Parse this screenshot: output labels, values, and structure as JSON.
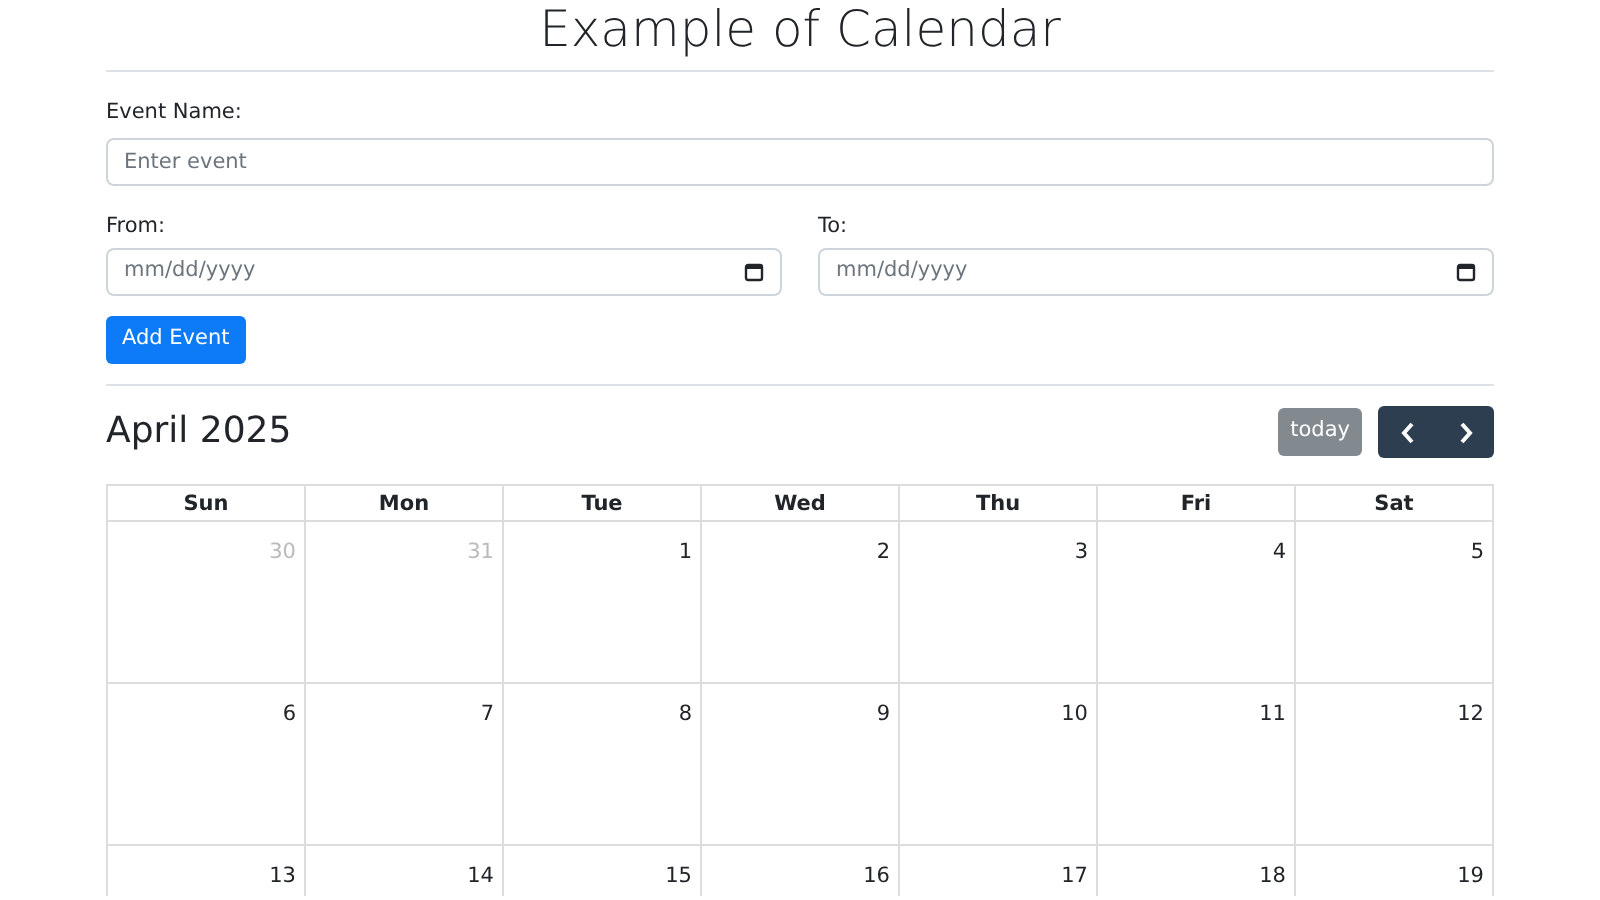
{
  "title": "Example of Calendar",
  "form": {
    "event_name": {
      "label": "Event Name:",
      "placeholder": "Enter event"
    },
    "from": {
      "label": "From:",
      "placeholder": "mm/dd/yyyy"
    },
    "to": {
      "label": "To:",
      "placeholder": "mm/dd/yyyy"
    },
    "submit": "Add Event"
  },
  "calendar": {
    "month": "April 2025",
    "today_button": {
      "label": "today",
      "disabled": true
    },
    "weekdays": [
      "Sun",
      "Mon",
      "Tue",
      "Wed",
      "Thu",
      "Fri",
      "Sat"
    ],
    "weeks": [
      [
        {
          "day": "30",
          "other_month": true
        },
        {
          "day": "31",
          "other_month": true
        },
        {
          "day": "1",
          "other_month": false
        },
        {
          "day": "2",
          "other_month": false
        },
        {
          "day": "3",
          "other_month": false
        },
        {
          "day": "4",
          "other_month": false
        },
        {
          "day": "5",
          "other_month": false
        }
      ],
      [
        {
          "day": "6",
          "other_month": false
        },
        {
          "day": "7",
          "other_month": false
        },
        {
          "day": "8",
          "other_month": false
        },
        {
          "day": "9",
          "other_month": false
        },
        {
          "day": "10",
          "other_month": false
        },
        {
          "day": "11",
          "other_month": false
        },
        {
          "day": "12",
          "other_month": false
        }
      ],
      [
        {
          "day": "13",
          "other_month": false
        },
        {
          "day": "14",
          "other_month": false
        },
        {
          "day": "15",
          "other_month": false
        },
        {
          "day": "16",
          "other_month": false
        },
        {
          "day": "17",
          "other_month": false
        },
        {
          "day": "18",
          "other_month": false
        },
        {
          "day": "19",
          "other_month": false
        }
      ]
    ]
  }
}
